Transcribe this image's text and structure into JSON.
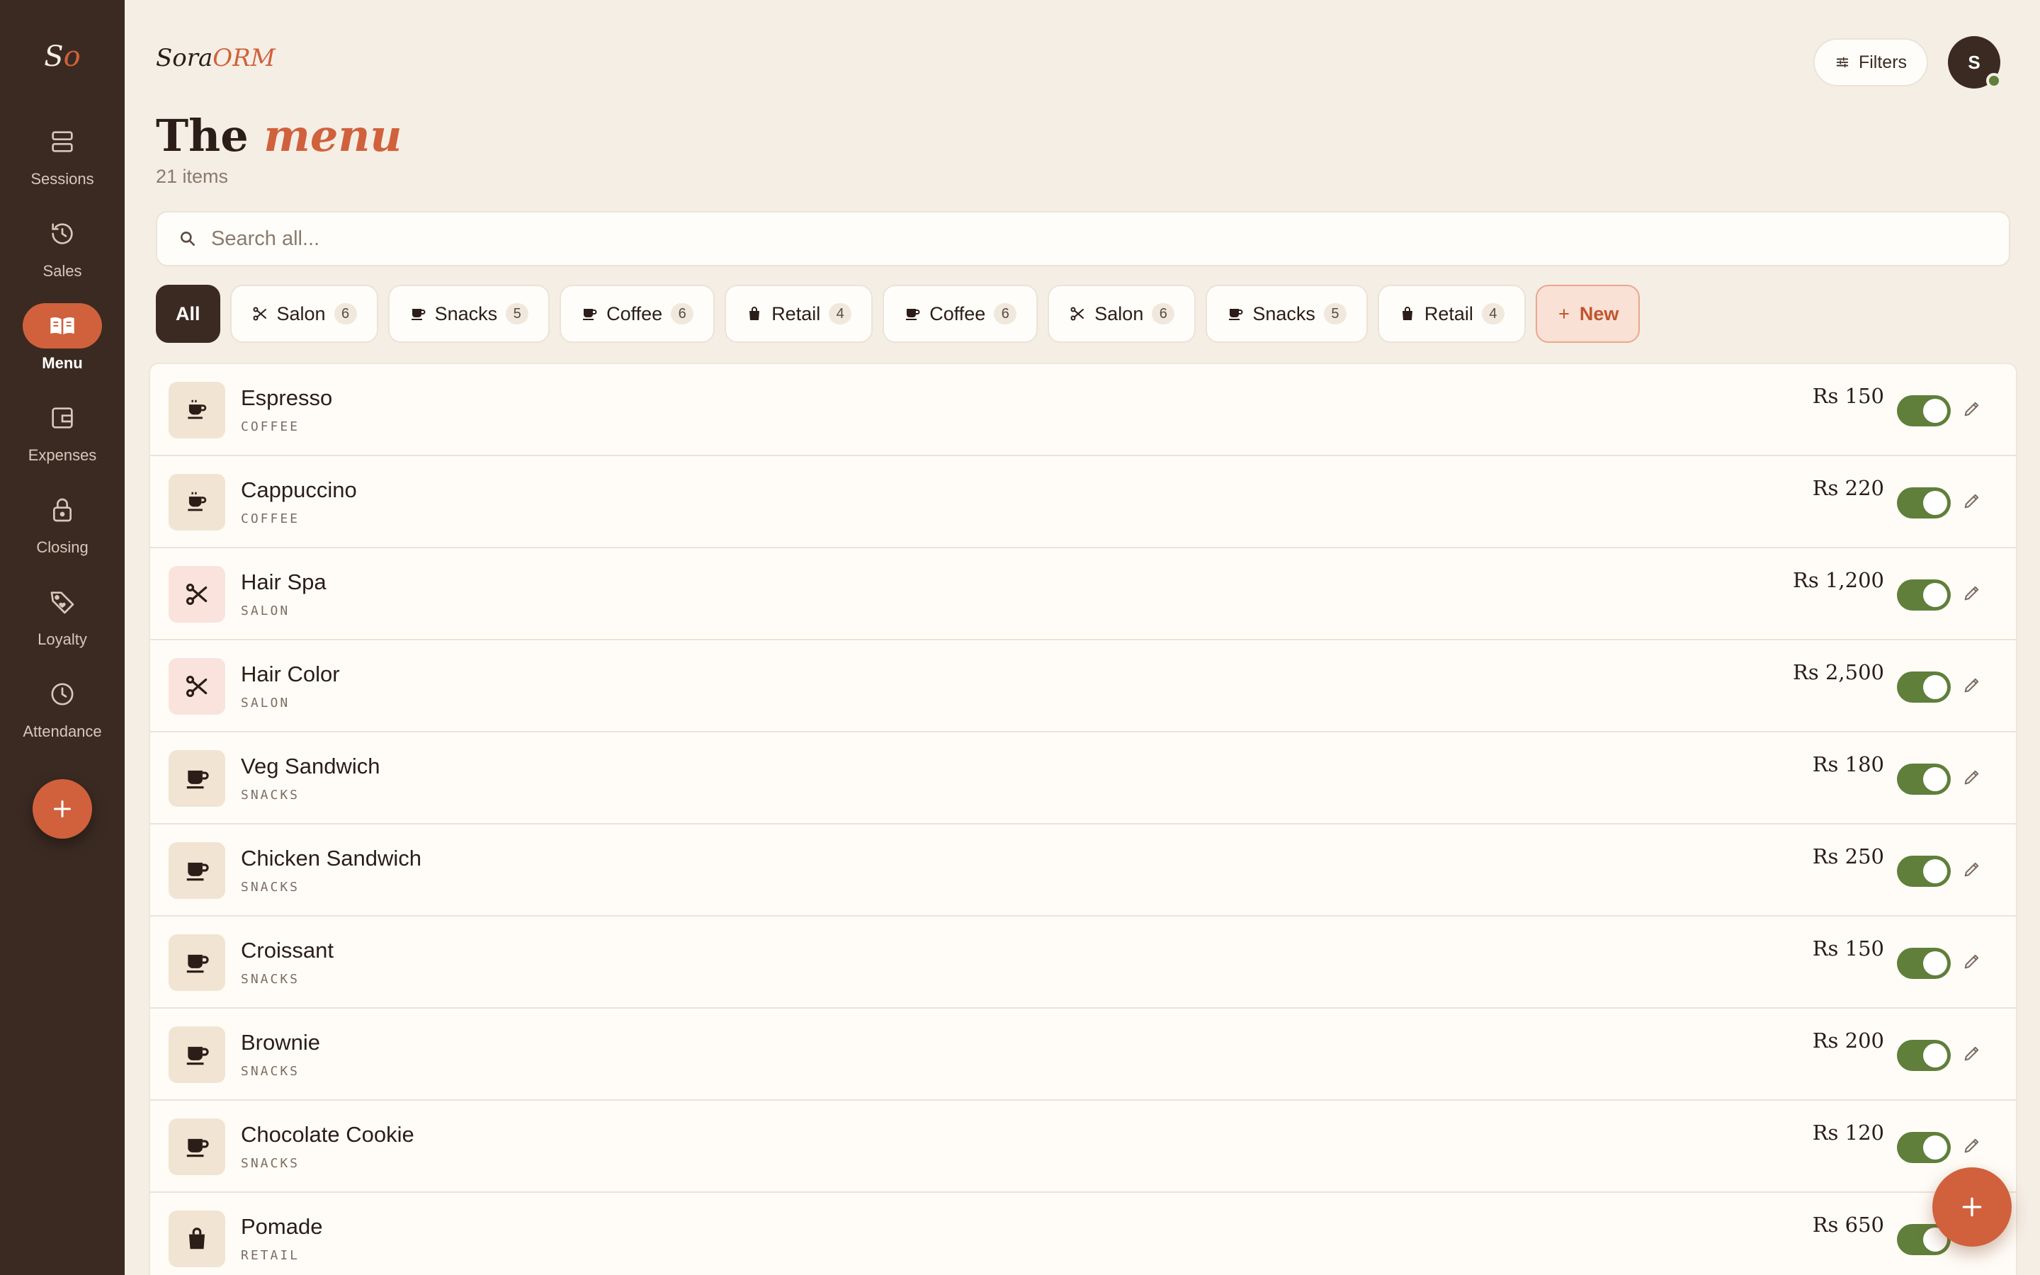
{
  "brand": {
    "mark_s": "S",
    "mark_o": "o",
    "logo_main": "Sora",
    "logo_accent": "ORM"
  },
  "colors": {
    "accent": "#d0613c",
    "sidebar": "#3a2a22",
    "toggle_on": "#5f7f3a",
    "background": "#f5eee5"
  },
  "sidebar": {
    "items": [
      {
        "label": "Sessions",
        "icon": "server-stack-icon",
        "active": false
      },
      {
        "label": "Sales",
        "icon": "history-icon",
        "active": false
      },
      {
        "label": "Menu",
        "icon": "book-open-icon",
        "active": true
      },
      {
        "label": "Expenses",
        "icon": "wallet-icon",
        "active": false
      },
      {
        "label": "Closing",
        "icon": "lock-icon",
        "active": false
      },
      {
        "label": "Loyalty",
        "icon": "tag-heart-icon",
        "active": false
      },
      {
        "label": "Attendance",
        "icon": "clock-icon",
        "active": false
      }
    ],
    "add_icon": "plus-icon"
  },
  "header": {
    "filters_label": "Filters",
    "avatar_initial": "S",
    "title_main": "The",
    "title_accent": "menu",
    "subtitle": "21 items"
  },
  "search": {
    "placeholder": "Search all..."
  },
  "chips": [
    {
      "label": "All",
      "type": "all"
    },
    {
      "label": "Salon",
      "count": "6",
      "icon": "scissors-icon"
    },
    {
      "label": "Snacks",
      "count": "5",
      "icon": "cup-icon"
    },
    {
      "label": "Coffee",
      "count": "6",
      "icon": "cup-icon"
    },
    {
      "label": "Retail",
      "count": "4",
      "icon": "bag-icon"
    },
    {
      "label": "Coffee",
      "count": "6",
      "icon": "cup-icon"
    },
    {
      "label": "Salon",
      "count": "6",
      "icon": "scissors-icon"
    },
    {
      "label": "Snacks",
      "count": "5",
      "icon": "cup-icon"
    },
    {
      "label": "Retail",
      "count": "4",
      "icon": "bag-icon"
    },
    {
      "label": "New",
      "type": "new",
      "icon": "plus-icon"
    }
  ],
  "items": [
    {
      "name": "Espresso",
      "category": "COFFEE",
      "price": "Rs 150",
      "enabled": true,
      "icon": "coffee-cup-icon"
    },
    {
      "name": "Cappuccino",
      "category": "COFFEE",
      "price": "Rs 220",
      "enabled": true,
      "icon": "coffee-cup-icon"
    },
    {
      "name": "Hair Spa",
      "category": "SALON",
      "price": "Rs 1,200",
      "enabled": true,
      "icon": "scissors-icon"
    },
    {
      "name": "Hair Color",
      "category": "SALON",
      "price": "Rs 2,500",
      "enabled": true,
      "icon": "scissors-icon"
    },
    {
      "name": "Veg Sandwich",
      "category": "SNACKS",
      "price": "Rs 180",
      "enabled": true,
      "icon": "mug-icon"
    },
    {
      "name": "Chicken Sandwich",
      "category": "SNACKS",
      "price": "Rs 250",
      "enabled": true,
      "icon": "mug-icon"
    },
    {
      "name": "Croissant",
      "category": "SNACKS",
      "price": "Rs 150",
      "enabled": true,
      "icon": "mug-icon"
    },
    {
      "name": "Brownie",
      "category": "SNACKS",
      "price": "Rs 200",
      "enabled": true,
      "icon": "mug-icon"
    },
    {
      "name": "Chocolate Cookie",
      "category": "SNACKS",
      "price": "Rs 120",
      "enabled": true,
      "icon": "mug-icon"
    },
    {
      "name": "Pomade",
      "category": "RETAIL",
      "price": "Rs 650",
      "enabled": true,
      "icon": "shopping-bag-icon"
    }
  ],
  "fab_icon": "plus-icon"
}
